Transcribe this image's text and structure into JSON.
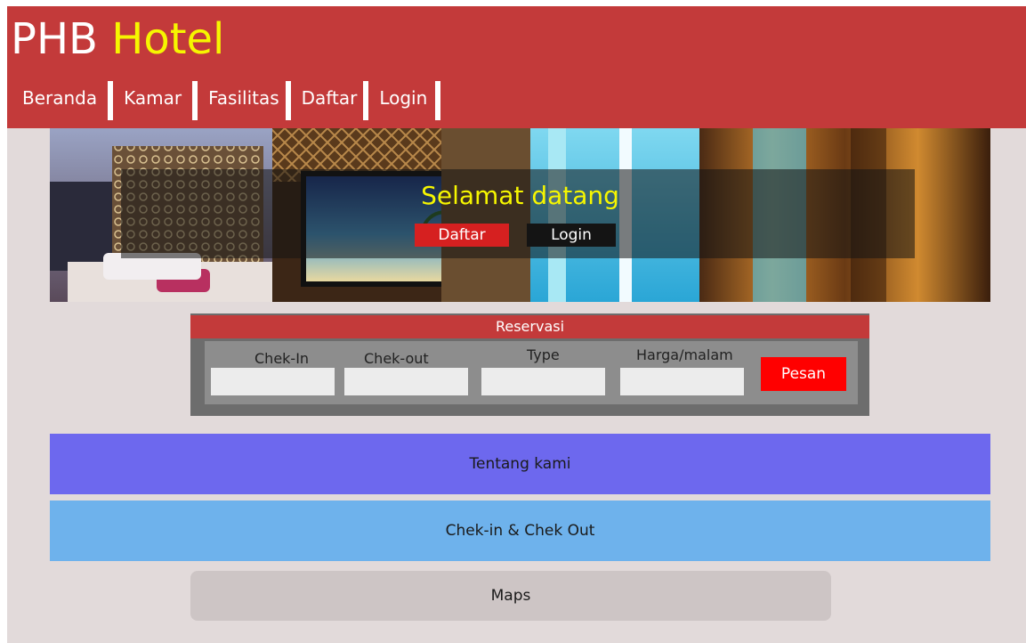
{
  "brand": {
    "part1": "PHB",
    "part2": "Hotel"
  },
  "nav": [
    {
      "label": "Beranda"
    },
    {
      "label": "Kamar"
    },
    {
      "label": "Fasilitas"
    },
    {
      "label": "Daftar"
    },
    {
      "label": "Login"
    }
  ],
  "hero": {
    "title": "Selamat datang",
    "daftar_label": "Daftar",
    "login_label": "Login"
  },
  "reservasi": {
    "title": "Reservasi",
    "fields": [
      {
        "label": "Chek-In",
        "value": ""
      },
      {
        "label": "Chek-out",
        "value": ""
      },
      {
        "label": "Type",
        "value": ""
      },
      {
        "label": "Harga/malam",
        "value": ""
      }
    ],
    "button_label": "Pesan"
  },
  "sections": {
    "about": "Tentang kami",
    "checkin": "Chek-in & Chek Out",
    "maps": "Maps"
  },
  "colors": {
    "header": "#c33a3a",
    "brand_accent": "#f6f600",
    "about": "#6d68ee",
    "checkin": "#6eb2ec",
    "pesan": "#ff0000"
  }
}
